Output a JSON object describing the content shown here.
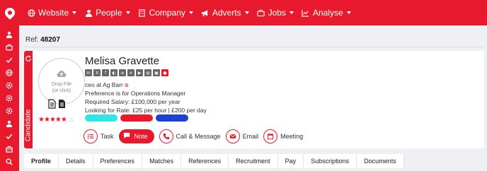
{
  "nav": {
    "items": [
      {
        "label": "Website",
        "icon": "globe-icon"
      },
      {
        "label": "People",
        "icon": "person-icon"
      },
      {
        "label": "Company",
        "icon": "building-icon"
      },
      {
        "label": "Adverts",
        "icon": "megaphone-icon"
      },
      {
        "label": "Jobs",
        "icon": "briefcase-icon"
      },
      {
        "label": "Analyse",
        "icon": "chart-icon"
      }
    ]
  },
  "sidebar": {
    "icons": [
      "person-icon",
      "briefcase-icon",
      "check-icon",
      "globe-icon",
      "gear-icon",
      "gear-icon",
      "gear-icon",
      "person-icon",
      "check-icon",
      "toolbox-icon",
      "search-icon"
    ]
  },
  "ref": {
    "label": "Ref:",
    "value": "48207"
  },
  "candidate": {
    "strip_label": "Candidate",
    "drop_file_line1": "Drop File",
    "drop_file_line2": "(or click)",
    "rating_stars": 5,
    "name": "Melisa Gravette",
    "role": "ceo at Ag Barr",
    "preference": "Preference is for Operations Manager",
    "salary": "Required Salary: £100,000 per year",
    "rate": "Looking for Rate: £25 per hour | £200 per day",
    "tag_colors": [
      "#2ee6e6",
      "#e8192c",
      "#1e3fd1"
    ]
  },
  "actions": {
    "task": "Task",
    "note": "Note",
    "call": "Call & Message",
    "email": "Email",
    "meeting": "Meeting"
  },
  "tabs": [
    "Profile",
    "Details",
    "Preferences",
    "Matches",
    "References",
    "Recruitment",
    "Pay",
    "Subscriptions",
    "Documents"
  ],
  "colors": {
    "brand": "#e8192c"
  }
}
